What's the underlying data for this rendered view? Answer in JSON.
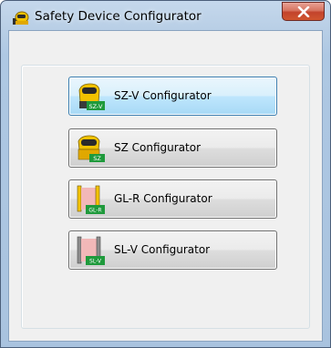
{
  "window": {
    "title": "Safety Device Configurator",
    "close_glyph": "x"
  },
  "buttons": [
    {
      "label": "SZ-V Configurator",
      "badge": "SZ-V",
      "icon": "sz-v-scanner-icon",
      "focused": true
    },
    {
      "label": "SZ Configurator",
      "badge": "SZ",
      "icon": "sz-scanner-icon",
      "focused": false
    },
    {
      "label": "GL-R Configurator",
      "badge": "GL-R",
      "icon": "gl-r-light-curtain-icon",
      "focused": false
    },
    {
      "label": "SL-V Configurator",
      "badge": "SL-V",
      "icon": "sl-v-light-curtain-icon",
      "focused": false
    }
  ],
  "colors": {
    "badge_green": "#1f9a3c",
    "scanner_yellow": "#f2c200",
    "curtain_pink": "#f2b8b8"
  }
}
